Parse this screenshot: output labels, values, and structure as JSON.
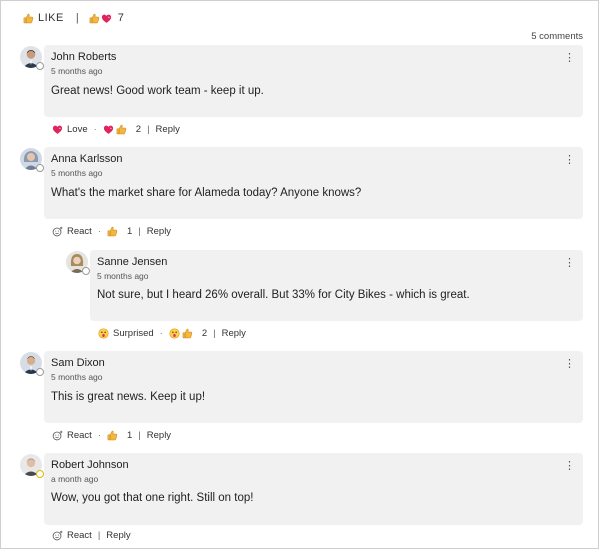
{
  "topbar": {
    "like_label": "LIKE",
    "reaction_count": "7"
  },
  "comment_count": "5 comments",
  "comments": [
    {
      "name": "John Roberts",
      "time": "5 months ago",
      "text": "Great news! Good work team - keep it up.",
      "action_label": "Love",
      "reaction_count": "2",
      "reply_label": "Reply",
      "status": "offline"
    },
    {
      "name": "Anna Karlsson",
      "time": "5 months ago",
      "text": "What's the market share for Alameda today? Anyone knows?",
      "action_label": "React",
      "reaction_count": "1",
      "reply_label": "Reply",
      "status": "offline"
    },
    {
      "name": "Sanne Jensen",
      "time": "5 months ago",
      "text": "Not sure, but I heard 26% overall. But 33% for City Bikes - which is great.",
      "action_label": "Surprised",
      "reaction_count": "2",
      "reply_label": "Reply",
      "status": "offline"
    },
    {
      "name": "Sam Dixon",
      "time": "5 months ago",
      "text": "This is great news. Keep it up!",
      "action_label": "React",
      "reaction_count": "1",
      "reply_label": "Reply",
      "status": "offline"
    },
    {
      "name": "Robert Johnson",
      "time": "a month ago",
      "text": "Wow, you got that one right. Still on top!",
      "action_label": "React",
      "reply_label": "Reply",
      "status": "away"
    }
  ],
  "colors": {
    "bubble": "#f1f1f1",
    "heart": "#e0245e",
    "thumb": "#f4b63f"
  }
}
